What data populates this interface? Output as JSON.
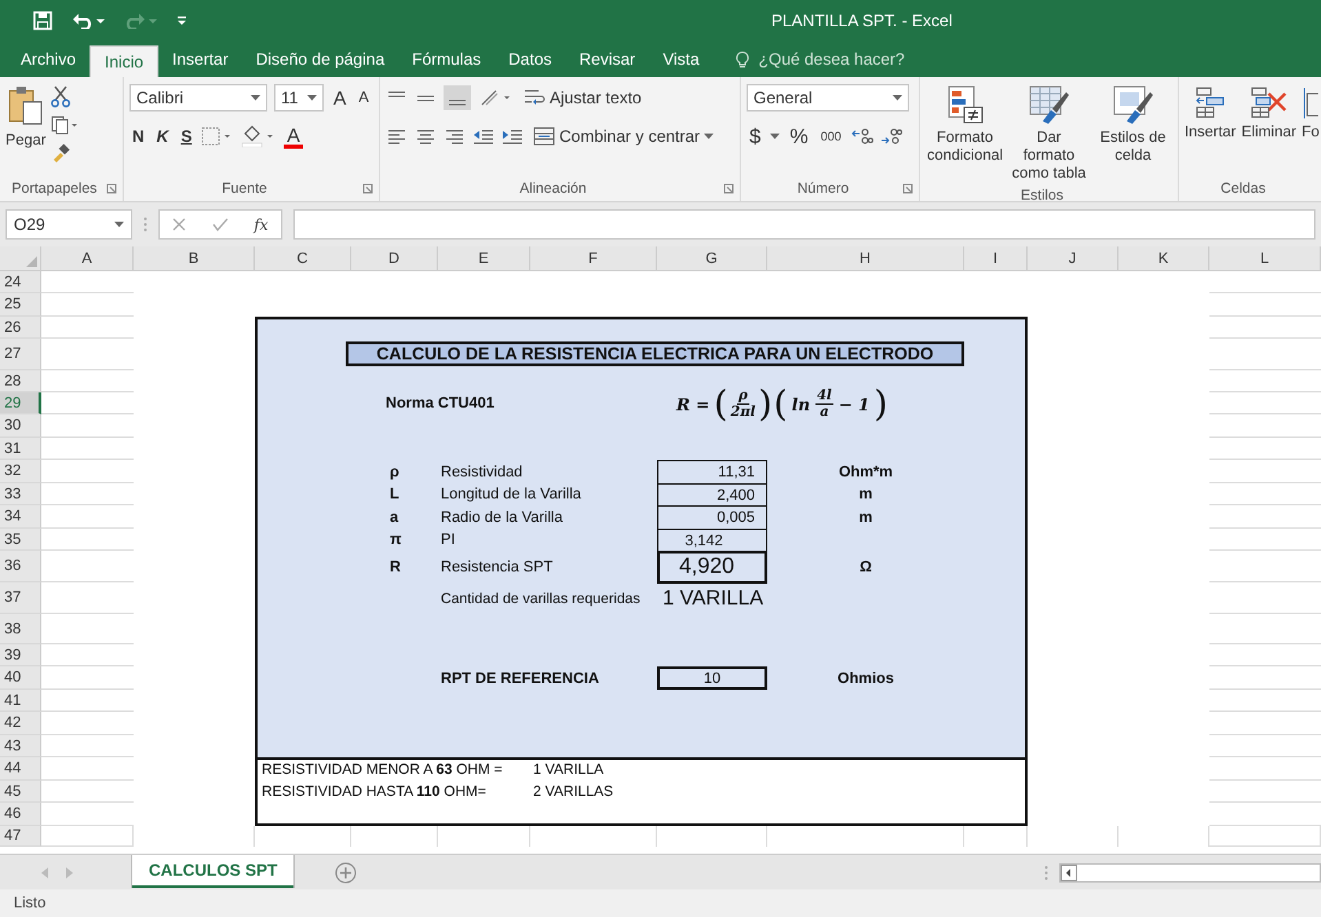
{
  "window": {
    "title": "PLANTILLA SPT. - Excel"
  },
  "ribbon_tabs": [
    {
      "label": "Archivo",
      "selected": false
    },
    {
      "label": "Inicio",
      "selected": true
    },
    {
      "label": "Insertar",
      "selected": false
    },
    {
      "label": "Diseño de página",
      "selected": false
    },
    {
      "label": "Fórmulas",
      "selected": false
    },
    {
      "label": "Datos",
      "selected": false
    },
    {
      "label": "Revisar",
      "selected": false
    },
    {
      "label": "Vista",
      "selected": false
    }
  ],
  "tell_me": {
    "placeholder": "¿Qué desea hacer?"
  },
  "ribbon": {
    "clipboard": {
      "paste": "Pegar",
      "group": "Portapapeles"
    },
    "font": {
      "font_name": "Calibri",
      "font_size": "11",
      "grow": "A",
      "shrink": "A",
      "bold": "N",
      "italic": "K",
      "underline": "S",
      "font_color": "A",
      "group": "Fuente"
    },
    "alignment": {
      "wrap": "Ajustar texto",
      "merge": "Combinar y centrar",
      "group": "Alineación"
    },
    "number": {
      "format": "General",
      "currency": "$",
      "percent": "%",
      "thousands": "000",
      "group": "Número"
    },
    "styles": {
      "conditional": "Formato condicional",
      "as_table": "Dar formato como tabla",
      "cell_styles": "Estilos de celda",
      "group": "Estilos"
    },
    "cells": {
      "insert": "Insertar",
      "delete": "Eliminar",
      "format": "Fo",
      "group": "Celdas"
    }
  },
  "name_box": "O29",
  "function_label": "fx",
  "columns": [
    "A",
    "B",
    "C",
    "D",
    "E",
    "F",
    "G",
    "H",
    "I",
    "J",
    "K",
    "L"
  ],
  "rows": [
    {
      "label": "24",
      "selected": false
    },
    {
      "label": "25",
      "selected": false
    },
    {
      "label": "26",
      "selected": false
    },
    {
      "label": "27",
      "selected": false
    },
    {
      "label": "28",
      "selected": false
    },
    {
      "label": "29",
      "selected": true
    },
    {
      "label": "30",
      "selected": false
    },
    {
      "label": "31",
      "selected": false
    },
    {
      "label": "32",
      "selected": false
    },
    {
      "label": "33",
      "selected": false
    },
    {
      "label": "34",
      "selected": false
    },
    {
      "label": "35",
      "selected": false
    },
    {
      "label": "36",
      "selected": false
    },
    {
      "label": "37",
      "selected": false
    },
    {
      "label": "38",
      "selected": false
    },
    {
      "label": "39",
      "selected": false
    },
    {
      "label": "40",
      "selected": false
    },
    {
      "label": "41",
      "selected": false
    },
    {
      "label": "42",
      "selected": false
    },
    {
      "label": "43",
      "selected": false
    },
    {
      "label": "44",
      "selected": false
    },
    {
      "label": "45",
      "selected": false
    },
    {
      "label": "46",
      "selected": false
    },
    {
      "label": "47",
      "selected": false
    }
  ],
  "sheet": {
    "title": "CALCULO DE LA RESISTENCIA ELECTRICA PARA UN ELECTRODO",
    "norma": "Norma CTU401",
    "formula": [
      {
        "kind": "text",
        "text": "R ="
      },
      {
        "kind": "paren",
        "text": "("
      },
      {
        "kind": "frac",
        "num": "ρ",
        "den": "2πl"
      },
      {
        "kind": "paren",
        "text": ")"
      },
      {
        "kind": "paren",
        "text": "("
      },
      {
        "kind": "text",
        "text": "ln"
      },
      {
        "kind": "frac",
        "num": "4l",
        "den": "a"
      },
      {
        "kind": "text",
        "text": "− 1"
      },
      {
        "kind": "paren",
        "text": ")"
      }
    ],
    "params": [
      {
        "kind": "input",
        "symbol": "ρ",
        "label": "Resistividad",
        "value": "11,31",
        "unit": "Ohm*m"
      },
      {
        "kind": "input",
        "symbol": "L",
        "label": "Longitud de la Varilla",
        "value": "2,400",
        "unit": "m"
      },
      {
        "kind": "input",
        "symbol": "a",
        "label": "Radio de la Varilla",
        "value": "0,005",
        "unit": "m"
      },
      {
        "kind": "constant",
        "symbol": "π",
        "label": "PI",
        "value": "3,142"
      },
      {
        "kind": "result",
        "symbol": "R",
        "label": "Resistencia SPT",
        "value": "4,920",
        "unit": "Ω"
      }
    ],
    "quantity": {
      "label": "Cantidad de varillas requeridas",
      "value": "1 VARILLA"
    },
    "reference": {
      "label": "RPT DE REFERENCIA",
      "value": "10",
      "unit": "Ohmios"
    },
    "notes": [
      {
        "text": "RESISTIVIDAD MENOR A **63** OHM =",
        "result": "1 VARILLA"
      },
      {
        "text": "RESISTIVIDAD HASTA **110** OHM=",
        "result": "2 VARILLAS"
      }
    ]
  },
  "sheet_tabs": [
    {
      "label": "CALCULOS SPT",
      "selected": true
    }
  ],
  "status_bar": "Listo"
}
